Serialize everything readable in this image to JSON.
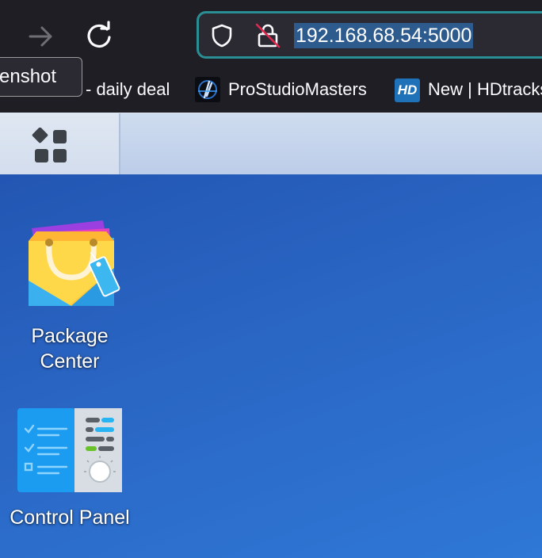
{
  "browser": {
    "url": "192.168.68.54:5000",
    "tooltip": "enshot",
    "bookmarks": [
      {
        "label": "- daily deal",
        "icon": "none"
      },
      {
        "label": "ProStudioMasters",
        "icon": "prostudiomasters-icon"
      },
      {
        "label": "New | HDtracks",
        "icon": "hd-icon",
        "icon_text": "HD"
      }
    ],
    "icons": [
      "forward-arrow-icon",
      "reload-icon",
      "shield-icon",
      "insecure-lock-icon"
    ],
    "accent_color": "#2a8f95"
  },
  "taskbar": {
    "main_menu_icon": "main-menu-icon"
  },
  "desktop": {
    "background_color": "#2a66c4",
    "apps": [
      {
        "label": "Package Center",
        "icon": "package-center-icon"
      },
      {
        "label": "Control Panel",
        "icon": "control-panel-icon"
      }
    ]
  }
}
